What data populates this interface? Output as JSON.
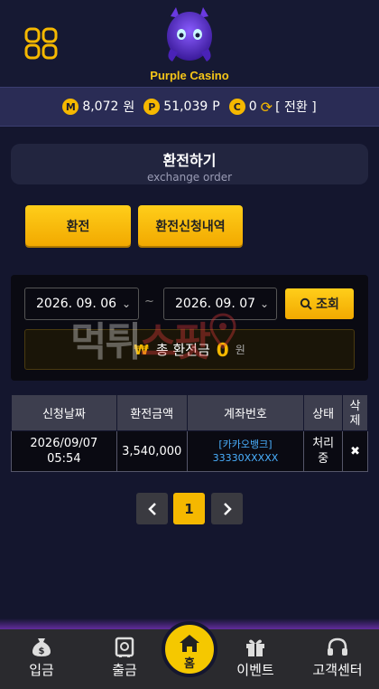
{
  "header": {
    "logo_text": "Purple Casino"
  },
  "balance": {
    "money_coin": "M",
    "money_value": "8,072",
    "money_unit": "원",
    "point_coin": "P",
    "point_value": "51,039",
    "point_unit": "P",
    "comp_coin": "C",
    "comp_value": "0",
    "convert_label": "[ 전환 ]"
  },
  "page_title": {
    "main": "환전하기",
    "sub": "exchange order"
  },
  "tabs": {
    "exchange_label": "환전",
    "history_label": "환전신청내역"
  },
  "filter": {
    "start_date": "2026. 09. 06",
    "end_date": "2026. 09. 07",
    "tilde": "~",
    "search_label": "조회",
    "total_currency": "₩",
    "total_label": "총 환전금",
    "total_value": "0",
    "total_unit": "원"
  },
  "watermark": {
    "part1": "먹튀",
    "part2": "스팟"
  },
  "table": {
    "headers": [
      "신청날짜",
      "환전금액",
      "계좌번호",
      "상태",
      "삭제"
    ],
    "rows": [
      {
        "date": "2026/09/07",
        "time": "05:54",
        "amount": "3,540,000",
        "bank": "[카카오뱅크]",
        "account": "33330XXXXX",
        "status_line1": "처리",
        "status_line2": "중",
        "delete": "✖"
      }
    ]
  },
  "pagination": {
    "prev": "‹",
    "current": "1",
    "next": "›"
  },
  "footer": {
    "deposit": "입금",
    "withdraw": "출금",
    "home": "홈",
    "event": "이벤트",
    "support": "고객센터"
  },
  "colors": {
    "accent": "#f5b800",
    "background": "#14162e",
    "link": "#4ab0ff"
  }
}
